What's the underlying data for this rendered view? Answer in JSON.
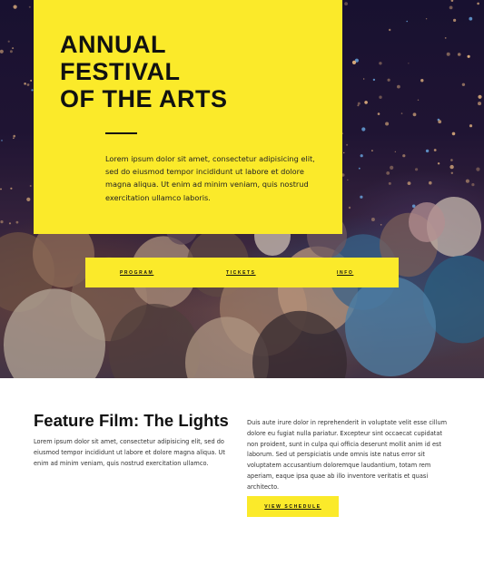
{
  "colors": {
    "accent_yellow": "#fbea2a",
    "text_dark": "#111111"
  },
  "hero": {
    "title_lines": [
      "ANNUAL",
      "FESTIVAL",
      "OF THE ARTS"
    ],
    "intro": "Lorem ipsum dolor sit amet, consectetur adipisicing elit, sed do eiusmod tempor incididunt ut labore et dolore magna aliqua. Ut enim ad minim veniam, quis nostrud exercitation ullamco laboris.",
    "image": "crowd-concert-photo"
  },
  "nav": {
    "items": [
      {
        "label": "PROGRAM"
      },
      {
        "label": "TICKETS"
      },
      {
        "label": "INFO"
      }
    ]
  },
  "feature": {
    "title": "Feature Film: The Lights",
    "text": "Lorem ipsum dolor sit amet, consectetur adipisicing elit, sed do eiusmod tempor incididunt ut labore et dolore magna aliqua. Ut enim ad minim veniam, quis nostrud exercitation ullamco.",
    "side_text": "Duis aute irure dolor in reprehenderit in voluptate velit esse cillum dolore eu fugiat nulla pariatur. Excepteur sint occaecat cupidatat non proident, sunt in culpa qui officia deserunt mollit anim id est laborum. Sed ut perspiciatis unde omnis iste natus error sit voluptatem accusantium doloremque laudantium, totam rem aperiam, eaque ipsa quae ab illo inventore veritatis et quasi architecto.",
    "button_label": "VIEW SCHEDULE"
  }
}
